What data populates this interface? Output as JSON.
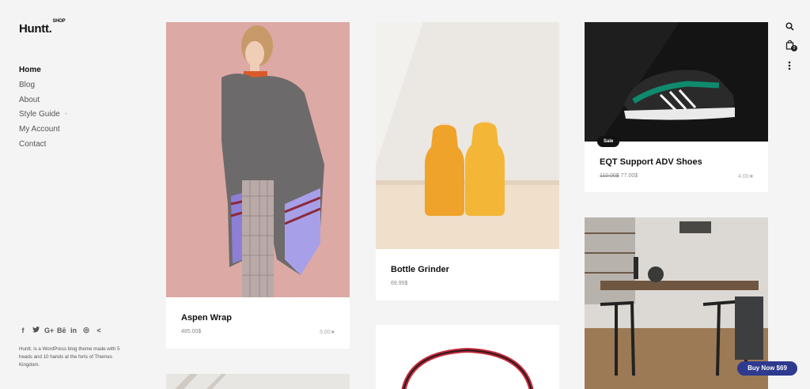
{
  "brand": {
    "name": "Huntt.",
    "tag": "SHOP"
  },
  "nav": [
    {
      "label": "Home"
    },
    {
      "label": "Blog"
    },
    {
      "label": "About"
    },
    {
      "label": "Style Guide",
      "sub": "+"
    },
    {
      "label": "My Account"
    },
    {
      "label": "Contact"
    }
  ],
  "social": {
    "facebook": "f",
    "twitter": "t",
    "google": "G+",
    "behance": "Bē",
    "linkedin": "in",
    "instagram": "◎",
    "share": "<"
  },
  "about": "Huntt. is a WordPress blog theme made with 5 heads and 10 hands at the forts of Themes Kingdom.",
  "products": [
    {
      "title": "Aspen Wrap",
      "price": "485.00$",
      "rating": "5.00★"
    },
    {
      "title": "Bottle Grinder",
      "price": "69.95$"
    },
    {
      "title": "EQT Support ADV Shoes",
      "old_price": "110.00$",
      "price": "77.00$",
      "rating": "4.00★",
      "badge": "Sale"
    }
  ],
  "cart_count": "0",
  "buy_now": "Buy Now $69"
}
